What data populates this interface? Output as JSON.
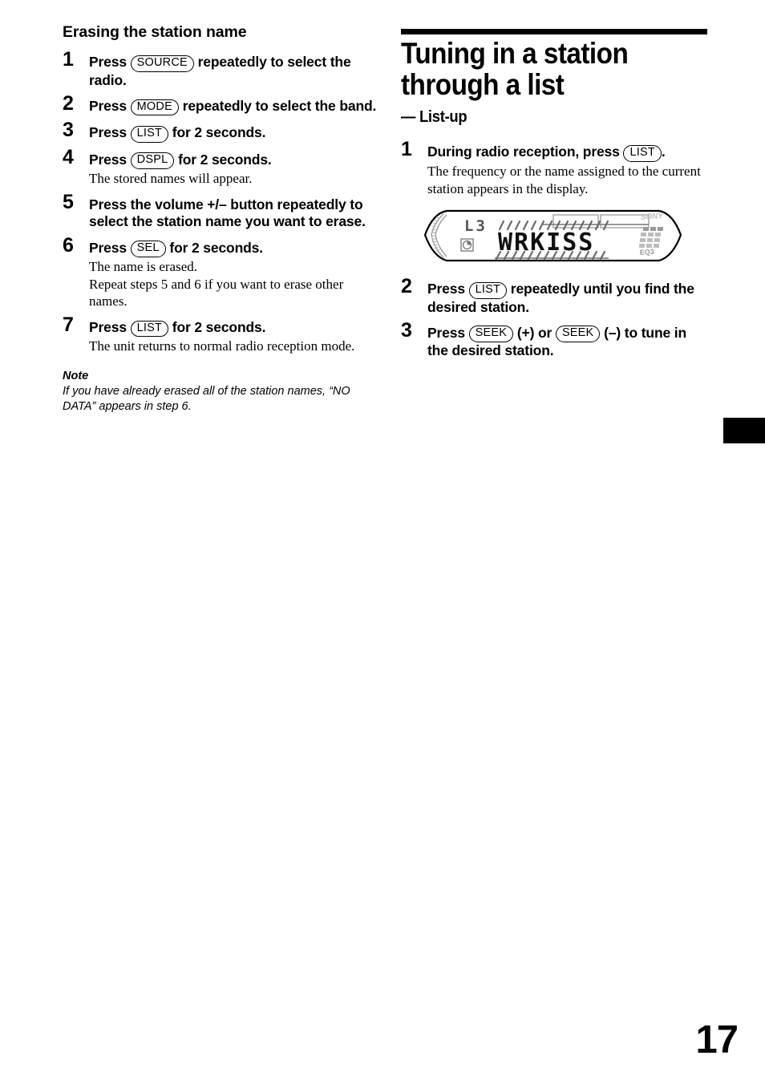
{
  "page": {
    "number": "17",
    "tab_marker_color": "#000000"
  },
  "left_column": {
    "heading": "Erasing the station name",
    "steps": [
      {
        "num": "1",
        "title_before": "Press",
        "button": "SOURCE",
        "title_after": "repeatedly to select the radio.",
        "body": ""
      },
      {
        "num": "2",
        "title_before": "Press",
        "button": "MODE",
        "title_after": "repeatedly to select the band.",
        "body": ""
      },
      {
        "num": "3",
        "title_before": "Press",
        "button": "LIST",
        "title_after": "for 2 seconds.",
        "body": ""
      },
      {
        "num": "4",
        "title_before": "Press",
        "button": "DSPL",
        "title_after": "for 2 seconds.",
        "body": "The stored names will appear."
      },
      {
        "num": "5",
        "title_before": "Press the volume +/– button repeatedly to select the station name you want to erase.",
        "button": "",
        "title_after": "",
        "body": ""
      },
      {
        "num": "6",
        "title_before": "Press",
        "button": "SEL",
        "title_after": "for 2 seconds.",
        "body": "The name is erased.\nRepeat steps 5 and 6 if you want to erase other names."
      },
      {
        "num": "7",
        "title_before": "Press",
        "button": "LIST",
        "title_after": "for 2 seconds.",
        "body": "The unit returns to normal radio reception mode."
      }
    ],
    "note": {
      "label": "Note",
      "text": "If you have already erased all of the station names, “NO DATA” appears in step 6."
    }
  },
  "right_column": {
    "heading": "Tuning in a station through a list",
    "subheading": "— List-up",
    "steps": [
      {
        "num": "1",
        "title_before": "During radio reception, press",
        "button": "LIST",
        "title_after": ".",
        "body": "The frequency or the name assigned to the current station appears in the display."
      },
      {
        "num": "2",
        "title_before": "Press",
        "button": "LIST",
        "title_after": "repeatedly until you find the desired station.",
        "body": ""
      },
      {
        "num": "3",
        "title_before": "Press",
        "button": "SEEK",
        "title_mid": "(+) or",
        "button2": "SEEK",
        "title_after": "(–) to tune in the desired station.",
        "body": ""
      }
    ],
    "display_illustration": {
      "name": "car-stereo-lcd-display",
      "band_indicator": "L3",
      "station_text": "WRKISS",
      "brand_logo": "SONY",
      "eq_label": "EQ3",
      "disc_icon": "disc-icon"
    }
  }
}
